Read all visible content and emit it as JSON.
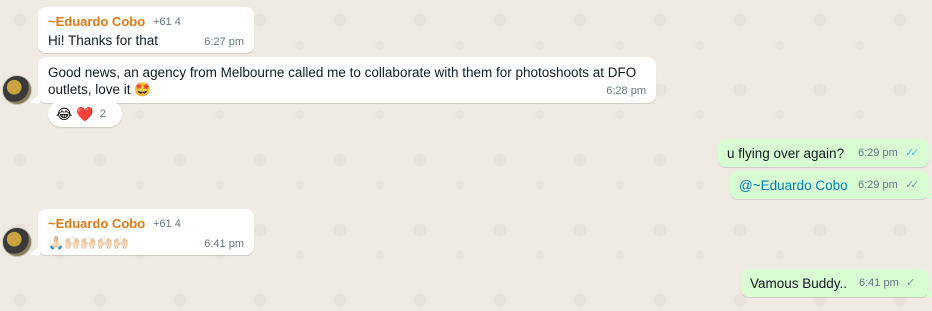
{
  "messages": [
    {
      "sender": "~Eduardo Cobo",
      "phone": "+61 4",
      "text": "Hi! Thanks for that",
      "time": "6:27 pm"
    },
    {
      "text_line1": "Good news, an agency from Melbourne called me to collaborate with them for photoshoots at DFO",
      "text_line2": "outlets, love it 🤩",
      "time": "6:28 pm",
      "reactions": "😂 ❤️",
      "reaction_count": "2"
    },
    {
      "text": "u flying over again?",
      "time": "6:29 pm",
      "ticks": "✓✓"
    },
    {
      "text": "@~Eduardo Cobo",
      "time": "6:29 pm",
      "ticks": "✓✓"
    },
    {
      "sender": "~Eduardo Cobo",
      "phone": "+61 4",
      "text": "🙏🏻🙌🏻🙌🏻🙌🏻🙌🏻",
      "time": "6:41 pm"
    },
    {
      "text": "Vamous Buddy..",
      "time": "6:41 pm",
      "ticks": "✓"
    }
  ],
  "colors": {
    "read": "#53bdeb",
    "delivered": "#8696a0",
    "sender": "#e07a16"
  }
}
